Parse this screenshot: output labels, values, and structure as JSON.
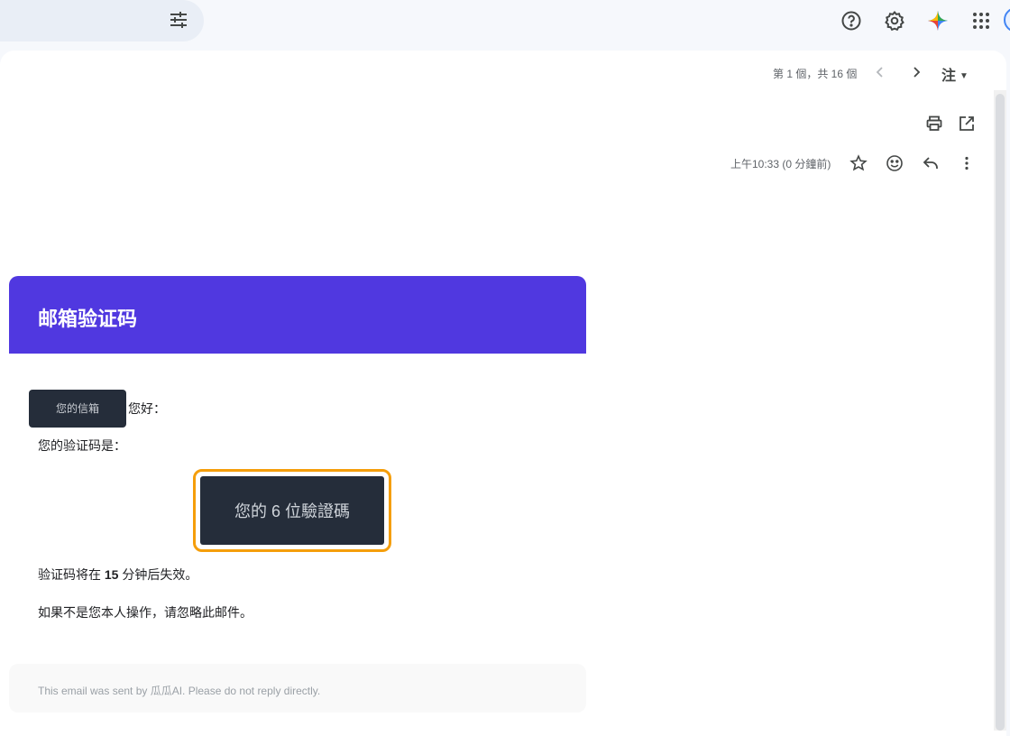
{
  "toolbar": {
    "search_options_icon": "tune-icon",
    "help_icon": "help-icon",
    "settings_icon": "gear-icon",
    "gemini_icon": "gemini-sparkle-icon",
    "apps_icon": "apps-grid-icon"
  },
  "pager": {
    "text": "第 1 個，共 16 個",
    "prev_icon": "chevron-left-icon",
    "next_icon": "chevron-right-icon"
  },
  "ime": {
    "label": "注"
  },
  "actions": {
    "print_icon": "print-icon",
    "popout_icon": "open-in-new-icon"
  },
  "message_meta": {
    "time": "上午10:33 (0 分鐘前)",
    "star_icon": "star-icon",
    "emoji_icon": "emoji-icon",
    "reply_icon": "reply-icon",
    "more_icon": "more-vert-icon"
  },
  "email": {
    "title": "邮箱验证码",
    "masked_email": "您的信箱",
    "greeting_suffix": "您好：",
    "code_intro": "您的验证码是：",
    "code_placeholder": "您的 6 位驗證碼",
    "expiry_prefix": "验证码将在 ",
    "expiry_minutes": "15",
    "expiry_suffix": " 分钟后失效。",
    "ignore_note": "如果不是您本人操作，请忽略此邮件。",
    "footer": "This email was sent by 瓜瓜AI. Please do not reply directly."
  },
  "colors": {
    "header_bg": "#5038e0",
    "code_border": "#f59e0b",
    "code_bg": "#252d3a"
  }
}
